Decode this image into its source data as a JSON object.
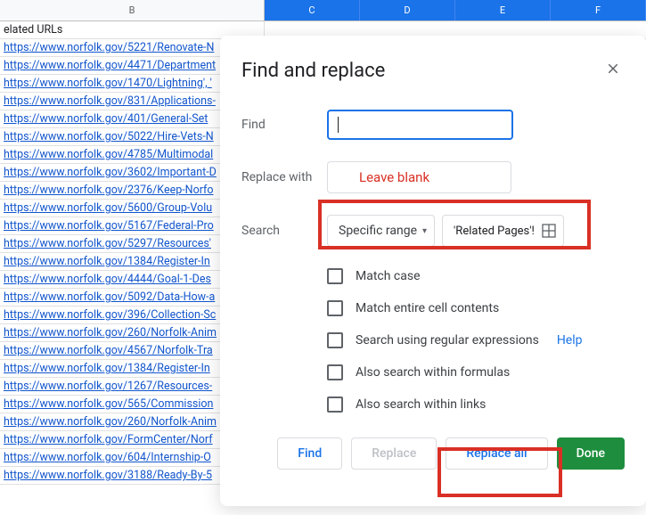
{
  "columns": {
    "b": "B",
    "c": "C",
    "d": "D",
    "e": "E",
    "f": "F"
  },
  "header_row": "elated URLs",
  "url_rows": [
    "https://www.norfolk.gov/5221/Renovate-N",
    "https://www.norfolk.gov/4471/Department",
    "https://www.norfolk.gov/1470/Lightning', '",
    "https://www.norfolk.gov/831/Applications-",
    "https://www.norfolk.gov/401/General-Set",
    "https://www.norfolk.gov/5022/Hire-Vets-N",
    "https://www.norfolk.gov/4785/Multimodal",
    "https://www.norfolk.gov/3602/Important-D",
    "https://www.norfolk.gov/2376/Keep-Norfo",
    "https://www.norfolk.gov/5600/Group-Volu",
    "https://www.norfolk.gov/5167/Federal-Pro",
    "https://www.norfolk.gov/5297/Resources'",
    "https://www.norfolk.gov/1384/Register-In",
    "https://www.norfolk.gov/4444/Goal-1-Des",
    "https://www.norfolk.gov/5092/Data-How-a",
    "https://www.norfolk.gov/396/Collection-Sc",
    "https://www.norfolk.gov/260/Norfolk-Anim",
    "https://www.norfolk.gov/4567/Norfolk-Tra",
    "https://www.norfolk.gov/1384/Register-In",
    "https://www.norfolk.gov/1267/Resources-",
    "https://www.norfolk.gov/565/Commission",
    "https://www.norfolk.gov/260/Norfolk-Anim",
    "https://www.norfolk.gov/FormCenter/Norf",
    "https://www.norfolk.gov/604/Internship-O",
    "https://www.norfolk.gov/3188/Ready-By-5"
  ],
  "dialog": {
    "title": "Find and replace",
    "find_label": "Find",
    "find_value": "|",
    "replace_label": "Replace with",
    "replace_annotation": "Leave blank",
    "search_label": "Search",
    "search_scope": "Specific range",
    "range_value": "'Related Pages'!",
    "checkboxes": {
      "match_case": "Match case",
      "match_entire": "Match entire cell contents",
      "regex": "Search using regular expressions",
      "formulas": "Also search within formulas",
      "links": "Also search within links"
    },
    "help_label": "Help",
    "buttons": {
      "find": "Find",
      "replace": "Replace",
      "replace_all": "Replace all",
      "done": "Done"
    }
  }
}
